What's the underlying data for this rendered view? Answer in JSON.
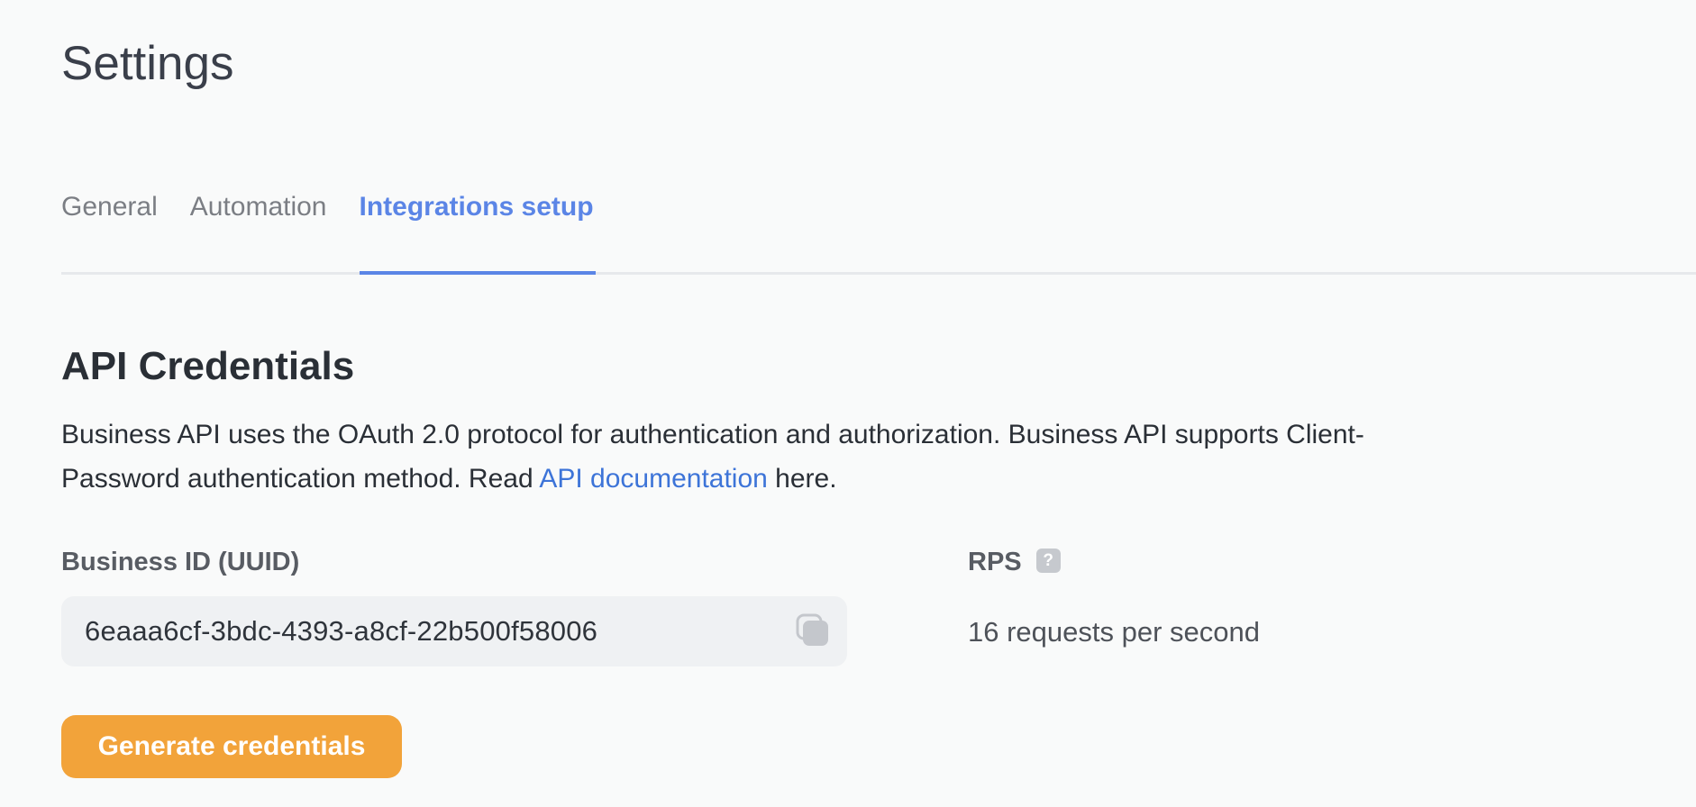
{
  "page": {
    "title": "Settings"
  },
  "tabs": [
    {
      "label": "General",
      "active": false
    },
    {
      "label": "Automation",
      "active": false
    },
    {
      "label": "Integrations setup",
      "active": true
    }
  ],
  "api_credentials": {
    "title": "API Credentials",
    "description_part1": "Business API uses the OAuth 2.0 protocol for authentication and authorization. Business API supports Client-Password authentication method. Read ",
    "doc_link_label": "API documentation",
    "description_part2": " here.",
    "business_id_label": "Business ID (UUID)",
    "business_id_value": "6eaaa6cf-3bdc-4393-a8cf-22b500f58006",
    "copy_icon": "copy-icon",
    "rps_label": "RPS",
    "rps_help_icon": "help-icon",
    "rps_help_glyph": "?",
    "rps_value": "16 requests per second",
    "generate_button_label": "Generate credentials"
  },
  "colors": {
    "accent": "#5b85e6",
    "link": "#3d74d8",
    "button": "#f2a33a",
    "background": "#f9fafa"
  }
}
